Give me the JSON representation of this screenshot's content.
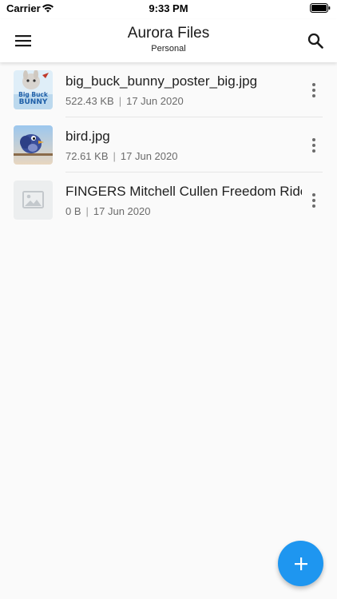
{
  "status_bar": {
    "carrier": "Carrier",
    "time": "9:33 PM"
  },
  "app_bar": {
    "title": "Aurora Files",
    "subtitle": "Personal",
    "menu_icon": "hamburger-menu-icon",
    "search_icon": "search-icon"
  },
  "files": [
    {
      "name": "big_buck_bunny_poster_big.jpg",
      "size": "522.43 KB",
      "date": "17 Jun 2020",
      "thumbnail": "bunny-poster"
    },
    {
      "name": "bird.jpg",
      "size": "72.61 KB",
      "date": "17 Jun 2020",
      "thumbnail": "bird"
    },
    {
      "name": "FINGERS Mitchell Cullen Freedom Ride",
      "size": "0 B",
      "date": "17 Jun 2020",
      "thumbnail": "image-placeholder"
    }
  ],
  "meta_separator": "|",
  "fab": {
    "icon": "plus-icon"
  },
  "colors": {
    "accent": "#1e96f0",
    "background": "#fafafa",
    "meta_text": "#6b6b6b"
  }
}
